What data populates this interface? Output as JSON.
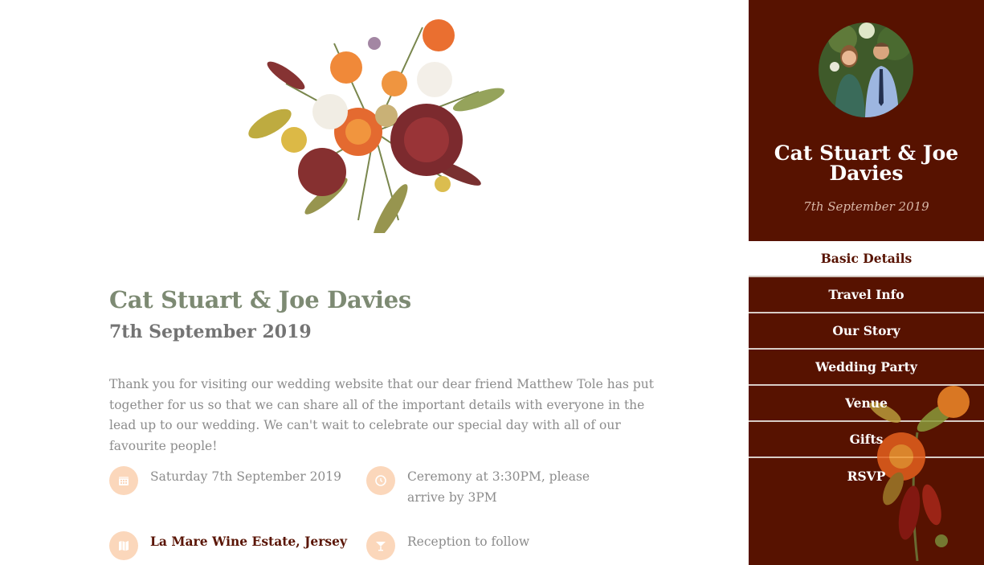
{
  "main": {
    "title": "Cat Stuart & Joe Davies",
    "date": "7th September 2019",
    "intro": "Thank you for visiting our wedding website that our dear friend Matthew Tole has put together for us so that we can share all of the important details with everyone in the lead up to our wedding. We can't wait to celebrate our special day with all of our favourite people!",
    "details": {
      "date": {
        "icon": "calendar-icon",
        "text": "Saturday 7th September 2019"
      },
      "time": {
        "icon": "clock-icon",
        "text": "Ceremony at 3:30PM, please arrive by 3PM"
      },
      "venue": {
        "icon": "map-icon",
        "text": "La Mare Wine Estate, Jersey"
      },
      "reception": {
        "icon": "cocktail-icon",
        "text": "Reception to follow"
      }
    }
  },
  "sidebar": {
    "title": "Cat Stuart & Joe Davies",
    "date": "7th September 2019",
    "nav": [
      "Basic Details",
      "Travel Info",
      "Our Story",
      "Wedding Party",
      "Venue",
      "Gifts",
      "RSVP"
    ],
    "active": "Basic Details"
  },
  "colors": {
    "sidebar_bg": "#571200",
    "title_green": "#7d8a73",
    "icon_circle": "#fbd7bb",
    "link": "#5a1505"
  }
}
